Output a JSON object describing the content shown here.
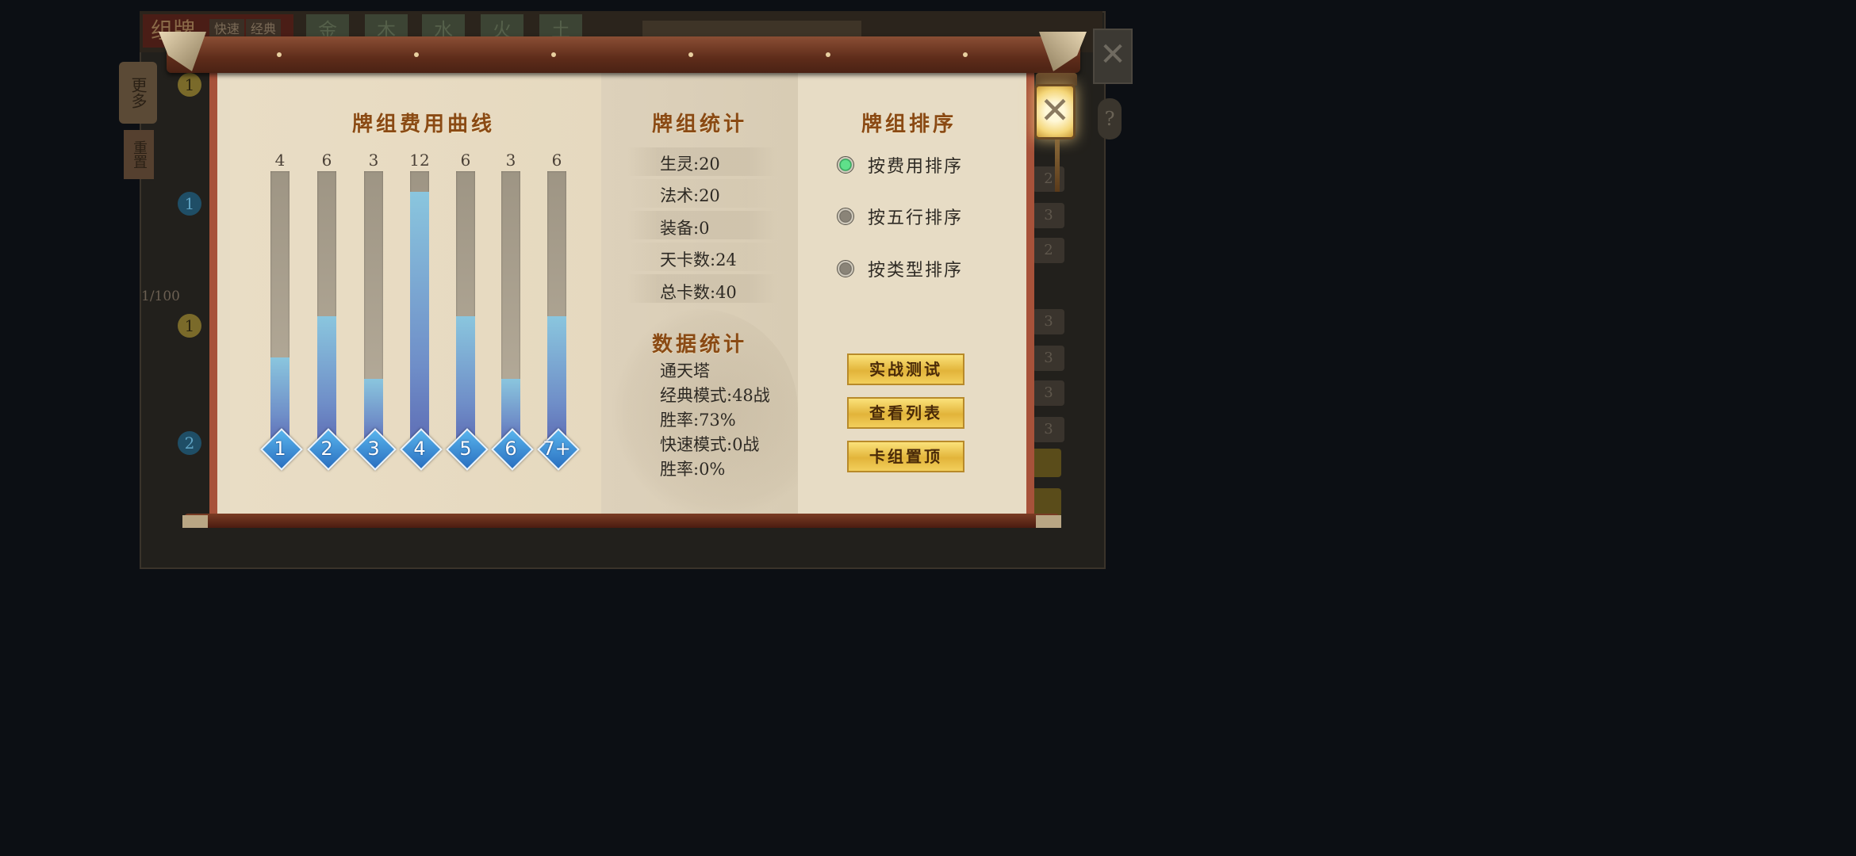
{
  "background": {
    "title": "组牌",
    "mode_tabs": [
      "快速",
      "经典"
    ],
    "element_tabs": [
      "金",
      "木",
      "水",
      "火",
      "土"
    ],
    "side_more": "更多",
    "side_reset": "重置",
    "page_indicator": "1/100"
  },
  "dialog": {
    "cost_curve": {
      "title": "牌组费用曲线"
    },
    "stats": {
      "title": "牌组统计",
      "rows": [
        "生灵:20",
        "法术:20",
        "装备:0",
        "天卡数:24",
        "总卡数:40"
      ]
    },
    "data_stats": {
      "title": "数据统计",
      "lines": [
        "通天塔",
        "经典模式:48战",
        "胜率:73%",
        "快速模式:0战",
        "胜率:0%"
      ]
    },
    "sort": {
      "title": "牌组排序",
      "options": [
        {
          "label": "按费用排序",
          "selected": true
        },
        {
          "label": "按五行排序",
          "selected": false
        },
        {
          "label": "按类型排序",
          "selected": false
        }
      ]
    },
    "buttons": {
      "battle_test": "实战测试",
      "view_list": "查看列表",
      "pin_deck": "卡组置顶"
    }
  },
  "chart_data": {
    "type": "bar",
    "title": "牌组费用曲线",
    "categories": [
      "1",
      "2",
      "3",
      "4",
      "5",
      "6",
      "7+"
    ],
    "values": [
      4,
      6,
      3,
      12,
      6,
      3,
      6
    ],
    "ylim": [
      0,
      13
    ]
  },
  "colors": {
    "title_brown": "#8a4a14",
    "bar_blue": "#7fb6da",
    "badge_blue": "#3a8fd8",
    "gold_button": "#f0c850",
    "radio_on": "#3fbf6a"
  }
}
